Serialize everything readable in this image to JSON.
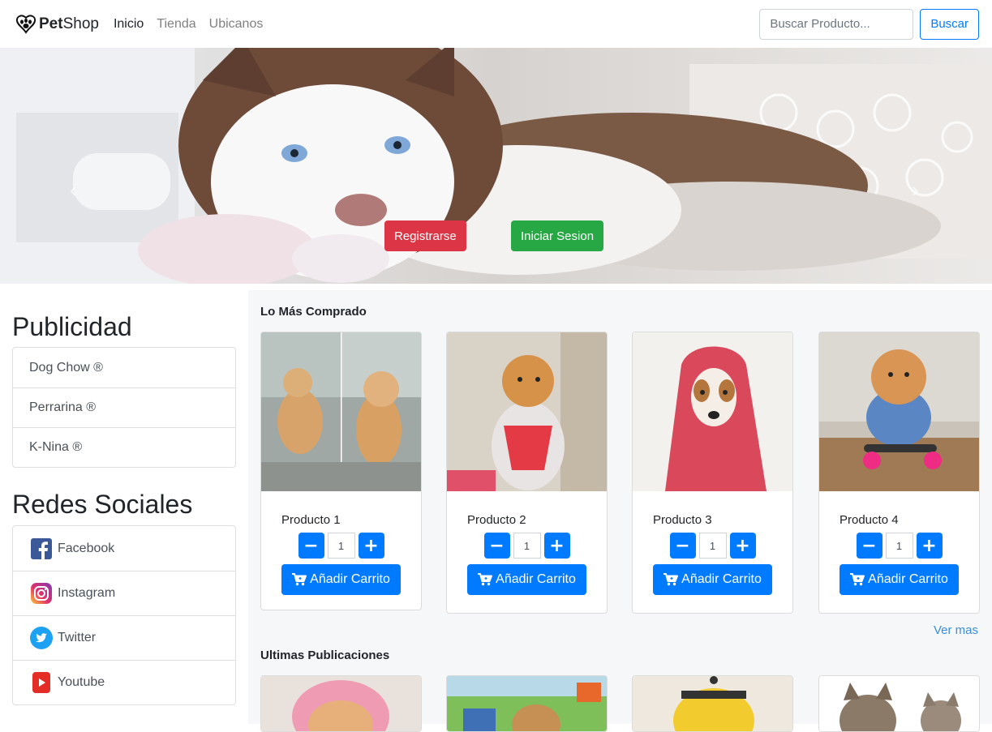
{
  "navbar": {
    "brand_bold": "Pet",
    "brand_rest": "Shop",
    "links": [
      "Inicio",
      "Tienda",
      "Ubicanos"
    ],
    "search_placeholder": "Buscar Producto...",
    "search_button": "Buscar"
  },
  "hero": {
    "register_button": "Registrarse",
    "login_button": "Iniciar Sesion",
    "prev_icon": "chevron-left-icon",
    "next_icon": "chevron-right-icon"
  },
  "sidebar": {
    "ads_title": "Publicidad",
    "ads": [
      "Dog Chow ®",
      "Perrarina ®",
      "K-Nina ®"
    ],
    "social_title": "Redes Sociales",
    "social": [
      {
        "label": "Facebook",
        "icon": "facebook-icon",
        "color": "#3b5998"
      },
      {
        "label": "Instagram",
        "icon": "instagram-icon",
        "color": "#c13584"
      },
      {
        "label": "Twitter",
        "icon": "twitter-icon",
        "color": "#1da1f2"
      },
      {
        "label": "Youtube",
        "icon": "youtube-icon",
        "color": "#e52d27"
      }
    ]
  },
  "main": {
    "best_sellers_title": "Lo Más Comprado",
    "products": [
      {
        "name": "Producto 1",
        "qty": "1"
      },
      {
        "name": "Producto 2",
        "qty": "1"
      },
      {
        "name": "Producto 3",
        "qty": "1"
      },
      {
        "name": "Producto 4",
        "qty": "1"
      }
    ],
    "add_to_cart": "Añadir Carrito",
    "minus": "−",
    "plus": "+",
    "see_more": "Ver mas",
    "latest_title": "Ultimas Publicaciones"
  },
  "colors": {
    "primary": "#007bff",
    "danger": "#dc3545",
    "success": "#28a745"
  }
}
